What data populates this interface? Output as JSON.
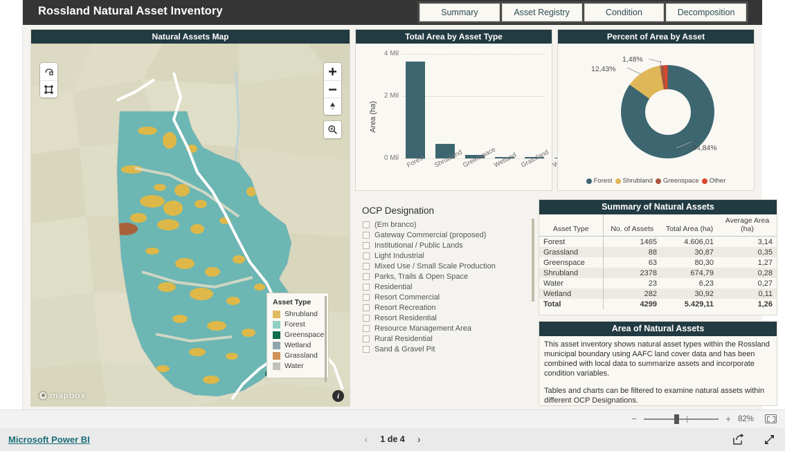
{
  "header": {
    "title": "Rossland Natural Asset Inventory",
    "tabs": [
      {
        "label": "Summary",
        "active": true
      },
      {
        "label": "Asset Registry",
        "active": false
      },
      {
        "label": "Condition",
        "active": false
      },
      {
        "label": "Decomposition",
        "active": false
      }
    ]
  },
  "map": {
    "title": "Natural Assets Map",
    "attribution": "mapbox",
    "info_icon": "i",
    "controls": [
      {
        "name": "pan-tool-icon",
        "glyph": "✐"
      },
      {
        "name": "select-tool-icon",
        "glyph": "▣"
      },
      {
        "name": "zoom-in-icon",
        "glyph": "+"
      },
      {
        "name": "zoom-out-icon",
        "glyph": "−"
      },
      {
        "name": "compass-icon",
        "glyph": "▲"
      },
      {
        "name": "search-icon",
        "glyph": "⌕"
      }
    ],
    "legend": {
      "title": "Asset Type",
      "items": [
        {
          "label": "Shrubland",
          "color": "#e0bb62"
        },
        {
          "label": "Forest",
          "color": "#8fcfc4"
        },
        {
          "label": "Greenspace",
          "color": "#0c6b4a"
        },
        {
          "label": "Wetland",
          "color": "#8fa6ae"
        },
        {
          "label": "Grassland",
          "color": "#cf9157"
        },
        {
          "label": "Water",
          "color": "#c2c2bb"
        }
      ]
    }
  },
  "chart_data": [
    {
      "type": "bar",
      "title": "Total Area by Asset Type",
      "xlabel": "",
      "ylabel": "Area (ha)",
      "categories": [
        "Forest",
        "Shrubland",
        "Greenspace",
        "Wetland",
        "Grassland",
        "Water"
      ],
      "values": [
        4606010,
        674790,
        80300,
        30920,
        30870,
        6230
      ],
      "ylim": [
        0,
        5000000
      ],
      "yticks": [
        "0 Mil",
        "2 Mil",
        "4 Mil"
      ],
      "ytick_values": [
        0,
        2000000,
        4000000
      ],
      "grid": true,
      "series_color": "#3d6671",
      "legend": "none"
    },
    {
      "type": "pie",
      "title": "Percent of Area by Asset",
      "donut": true,
      "categories": [
        "Forest",
        "Shrubland",
        "Greenspace",
        "Other"
      ],
      "values": [
        84.84,
        12.43,
        1.48,
        1.25
      ],
      "value_labels": [
        "84,84%",
        "12,43%",
        "1,48%",
        ""
      ],
      "colors": [
        "#3d6671",
        "#dfb758",
        "#a8553a",
        "#d9462e"
      ],
      "legend": "bottom",
      "legend_entries": [
        "Forest",
        "Shrubland",
        "Greenspace",
        "Other"
      ]
    }
  ],
  "ocp_slicer": {
    "title": "OCP Designation",
    "items": [
      {
        "label": "(Em branco)",
        "checked": false
      },
      {
        "label": "Gateway Commercial (proposed)",
        "checked": false
      },
      {
        "label": "Institutional / Public Lands",
        "checked": false
      },
      {
        "label": "Light Industrial",
        "checked": false
      },
      {
        "label": "Mixed Use / Small Scale Production",
        "checked": false
      },
      {
        "label": "Parks, Trails & Open Space",
        "checked": false
      },
      {
        "label": "Residential",
        "checked": false
      },
      {
        "label": "Resort Commercial",
        "checked": false
      },
      {
        "label": "Resort Recreation",
        "checked": false
      },
      {
        "label": "Resort Residential",
        "checked": false
      },
      {
        "label": "Resource Management Area",
        "checked": false
      },
      {
        "label": "Rural Residential",
        "checked": false
      },
      {
        "label": "Sand & Gravel Pit",
        "checked": false
      }
    ]
  },
  "summary_table": {
    "title": "Summary of Natural Assets",
    "columns": [
      "Asset Type",
      "No. of Assets",
      "Total Area (ha)",
      "Average Area (ha)"
    ],
    "rows": [
      {
        "asset_type": "Forest",
        "count": "1465",
        "total_area": "4.606,01",
        "avg_area": "3,14"
      },
      {
        "asset_type": "Grassland",
        "count": "88",
        "total_area": "30,87",
        "avg_area": "0,35"
      },
      {
        "asset_type": "Greenspace",
        "count": "63",
        "total_area": "80,30",
        "avg_area": "1,27"
      },
      {
        "asset_type": "Shrubland",
        "count": "2378",
        "total_area": "674,79",
        "avg_area": "0,28"
      },
      {
        "asset_type": "Water",
        "count": "23",
        "total_area": "6,23",
        "avg_area": "0,27"
      },
      {
        "asset_type": "Wetland",
        "count": "282",
        "total_area": "30,92",
        "avg_area": "0,11"
      }
    ],
    "total": {
      "asset_type": "Total",
      "count": "4299",
      "total_area": "5.429,11",
      "avg_area": "1,26"
    }
  },
  "text_card": {
    "title": "Area of Natural Assets",
    "paragraph1": "This asset inventory shows natural asset types within the Rossland municipal boundary using AAFC land cover data and has been combined with local data to summarize assets and incorporate condition variables.",
    "paragraph2": "Tables and charts can be filtered to examine natural assets within different OCP Designations."
  },
  "zoom_bar": {
    "minus": "−",
    "plus": "+",
    "percent": "82%"
  },
  "footer": {
    "link": "Microsoft Power BI",
    "prev": "‹",
    "next": "›",
    "page": "1 de 4"
  },
  "colors": {
    "header_bg": "#353535",
    "card_title_bg": "#223a42",
    "accent_teal": "#3d6671",
    "accent_gold": "#dfb758",
    "accent_rust": "#a8553a",
    "accent_red": "#d9462e",
    "link": "#1a6e78"
  }
}
